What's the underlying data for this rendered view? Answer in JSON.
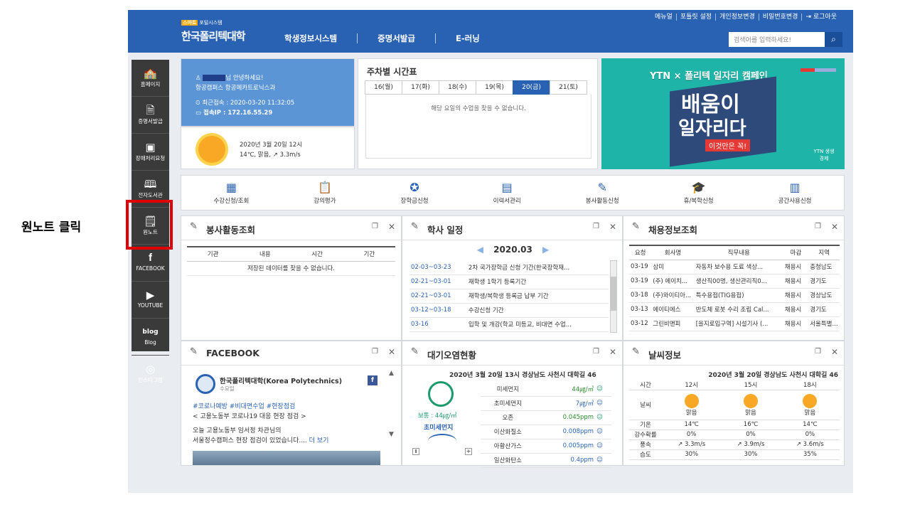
{
  "annotation": "원노트 클릭",
  "header": {
    "badge": "스마트",
    "badge_sub": "포털시스템",
    "title": "한국폴리텍대학",
    "nav": [
      "학생정보시스템",
      "증명서발급",
      "E-러닝"
    ],
    "util": [
      "메뉴얼",
      "포틀릿 설정",
      "개인정보변경",
      "비밀번호변경",
      "로그아웃"
    ],
    "search_placeholder": "검색어를 입력하세요!"
  },
  "sidebar": [
    {
      "label": "홈페이지",
      "icon": "school-icon"
    },
    {
      "label": "증명서발급",
      "icon": "document-icon"
    },
    {
      "label": "장애처리요청",
      "icon": "clipboard-icon"
    },
    {
      "label": "전자도서관",
      "icon": "book-icon"
    },
    {
      "label": "원노트",
      "icon": "onenote-icon"
    },
    {
      "label": "FACEBOOK",
      "icon": "facebook-icon"
    },
    {
      "label": "YOUTUBE",
      "icon": "youtube-icon"
    },
    {
      "label": "Blog",
      "icon": "blog-icon"
    },
    {
      "label": "인스타그램",
      "icon": "instagram-icon"
    }
  ],
  "welcome": {
    "greeting": "님 안녕하세요!",
    "campus": "항공캠퍼스 항공메카트로닉스과",
    "last_login": "최근접속 : 2020-03-20 11:32:05",
    "ip": "접속IP : 172.16.55.29",
    "weather_date": "2020년 3월 20일 12시",
    "weather_desc": "14℃, 맑음, ↗ 3.3m/s"
  },
  "timetable": {
    "title": "주차별 시간표",
    "days": [
      "16(월)",
      "17(화)",
      "18(수)",
      "19(목)",
      "20(금)",
      "21(토)"
    ],
    "selected": 4,
    "empty": "해당 요일의 수업을 찾을 수 없습니다."
  },
  "banner": {
    "top": "YTN × 폴리텍 일자리 캠페인",
    "line1": "배움이",
    "line2": "일자리다",
    "tag": "이것만은 꼭!",
    "brand": "YTN 생생경제"
  },
  "quick_menu": [
    {
      "label": "수강신청/조회",
      "icon": "register-icon"
    },
    {
      "label": "강의평가",
      "icon": "evaluation-icon"
    },
    {
      "label": "장학금신청",
      "icon": "scholarship-icon"
    },
    {
      "label": "이력서관리",
      "icon": "resume-icon"
    },
    {
      "label": "봉사활동신청",
      "icon": "volunteer-icon"
    },
    {
      "label": "휴/복학신청",
      "icon": "graduation-icon"
    },
    {
      "label": "공간사용신청",
      "icon": "space-icon"
    }
  ],
  "volunteer": {
    "title": "봉사활동조회",
    "headers": [
      "기관",
      "내용",
      "시간",
      "기간"
    ],
    "empty": "저장된 데이터를 찾을 수 없습니다."
  },
  "schedule": {
    "title": "학사 일정",
    "month": "2020.03",
    "rows": [
      {
        "date": "02-03~03-23",
        "text": "2차 국가장학금 신청 기간(한국장학재..."
      },
      {
        "date": "02-21~03-01",
        "text": "재학생 1학기 등록기간"
      },
      {
        "date": "02-21~03-01",
        "text": "재학생/복학생 등록금 납부 기간"
      },
      {
        "date": "03-12~03-18",
        "text": "수강신청 기간"
      },
      {
        "date": "03-16",
        "text": "입학 및 개강(학교 미등교, 비대면 수업..."
      }
    ]
  },
  "jobs": {
    "title": "채용정보조회",
    "headers": [
      "요청",
      "회사명",
      "직무내용",
      "마감",
      "지역"
    ],
    "rows": [
      [
        "03-19",
        "삼미",
        "자동차 보수용 도료 색상...",
        "채용시",
        "충청남도"
      ],
      [
        "03-19",
        "(주) 에이치...",
        "생산직00명, 생산관리직0...",
        "채용시",
        "경기도"
      ],
      [
        "03-18",
        "(주)와이티아...",
        "특수용접(TIG용접)",
        "채용시",
        "경상남도"
      ],
      [
        "03-13",
        "에이티에스",
        "반도체 로봇 수리 조립 Cal...",
        "채용시",
        "경기도"
      ],
      [
        "03-12",
        "그린비앤피",
        "[을지로입구역] 시설기사 (...",
        "채용시",
        "서울특별..."
      ]
    ]
  },
  "facebook": {
    "title": "FACEBOOK",
    "page": "한국폴리텍대학(Korea Polytechnics)",
    "day": "수요일",
    "tags": "#코로나예방 #비대면수업 #현장점검",
    "subtitle": "< 고용노동부 코로나19 대응 현장 점검 >",
    "body1": "오늘 고용노동부 임서정 차관님의",
    "body2": "서울정수캠퍼스 현장 점검이 있었습니다....",
    "more": "더 보기"
  },
  "air": {
    "title": "대기오염현황",
    "heading": "2020년 3월 20일 13시 경상남도 사천시 대학길 46",
    "status": "보통 : 44㎍/㎥",
    "sub": "초미세먼지",
    "rows": [
      {
        "name": "미세먼지",
        "value": "44㎍/㎥"
      },
      {
        "name": "초미세먼지",
        "value": "7㎍/㎥"
      },
      {
        "name": "오존",
        "value": "0.045ppm"
      },
      {
        "name": "이산화질소",
        "value": "0.008ppm"
      },
      {
        "name": "아황산가스",
        "value": "0.005ppm"
      },
      {
        "name": "일산화탄소",
        "value": "0.4ppm"
      }
    ]
  },
  "weather": {
    "title": "날씨정보",
    "heading": "2020년 3월 20일 경상남도 사천시 대학길 46",
    "labels": [
      "시간",
      "날씨",
      "기온",
      "강수확률",
      "풍속",
      "습도"
    ],
    "cols": [
      {
        "time": "12시",
        "sky": "맑음",
        "temp": "14℃",
        "rain": "0%",
        "wind": "↗ 3.3m/s",
        "hum": "30%"
      },
      {
        "time": "15시",
        "sky": "맑음",
        "temp": "16℃",
        "rain": "0%",
        "wind": "↗ 3.9m/s",
        "hum": "30%"
      },
      {
        "time": "18시",
        "sky": "맑음",
        "temp": "14℃",
        "rain": "0%",
        "wind": "↗ 3.6m/s",
        "hum": "35%"
      }
    ]
  }
}
